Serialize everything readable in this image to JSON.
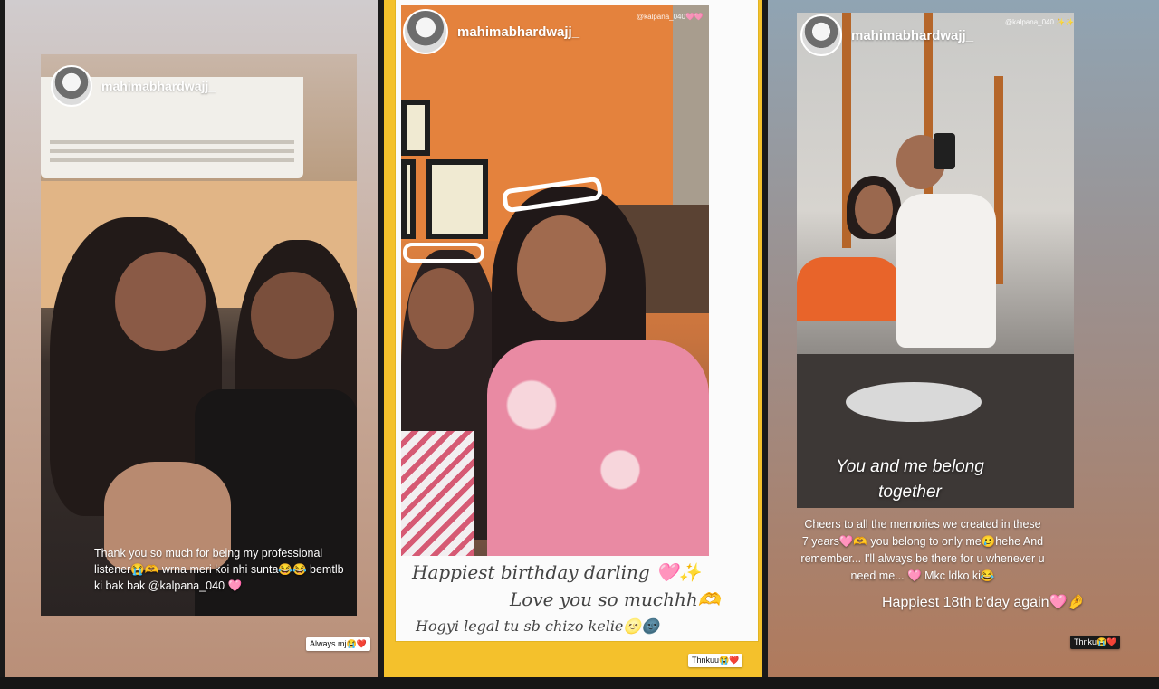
{
  "stories": [
    {
      "username": "mahimabhardwajj_",
      "caption": "Thank you so much for being my professional listener😭🫶 wrna meri koi nhi sunta😂😂 bemtlb ki bak bak @kalpana_040 🩷",
      "reply_sticker": "Always mj😭❤️"
    },
    {
      "username": "mahimabhardwajj_",
      "mention": "@kalpana_040🩷🩷",
      "caption_line1": "Happiest birthday darling 🩷✨",
      "caption_line2": "Love you so muchhh🫶",
      "caption_line3": "Hogyi legal tu sb chizo kelie🌝🌚",
      "reply_sticker": "Thnkuu😭❤️"
    },
    {
      "username": "mahimabhardwajj_",
      "mention": "@kalpana_040 ✨✨",
      "overlay_text": "You and me belong together",
      "caption": "Cheers to all the memories we created in these 7 years🩷🫶 you belong to only me🥲hehe And remember... I'll always be there for u whenever u need me... 🩷 Mkc ldko ki😂",
      "caption_highlight": "Happiest 18th b'day again🩷🤌",
      "reply_sticker": "Thnku😭❤️"
    }
  ],
  "colors": {
    "panel2_border": "#f4c12c",
    "heart_pink": "#ff7eb9"
  }
}
